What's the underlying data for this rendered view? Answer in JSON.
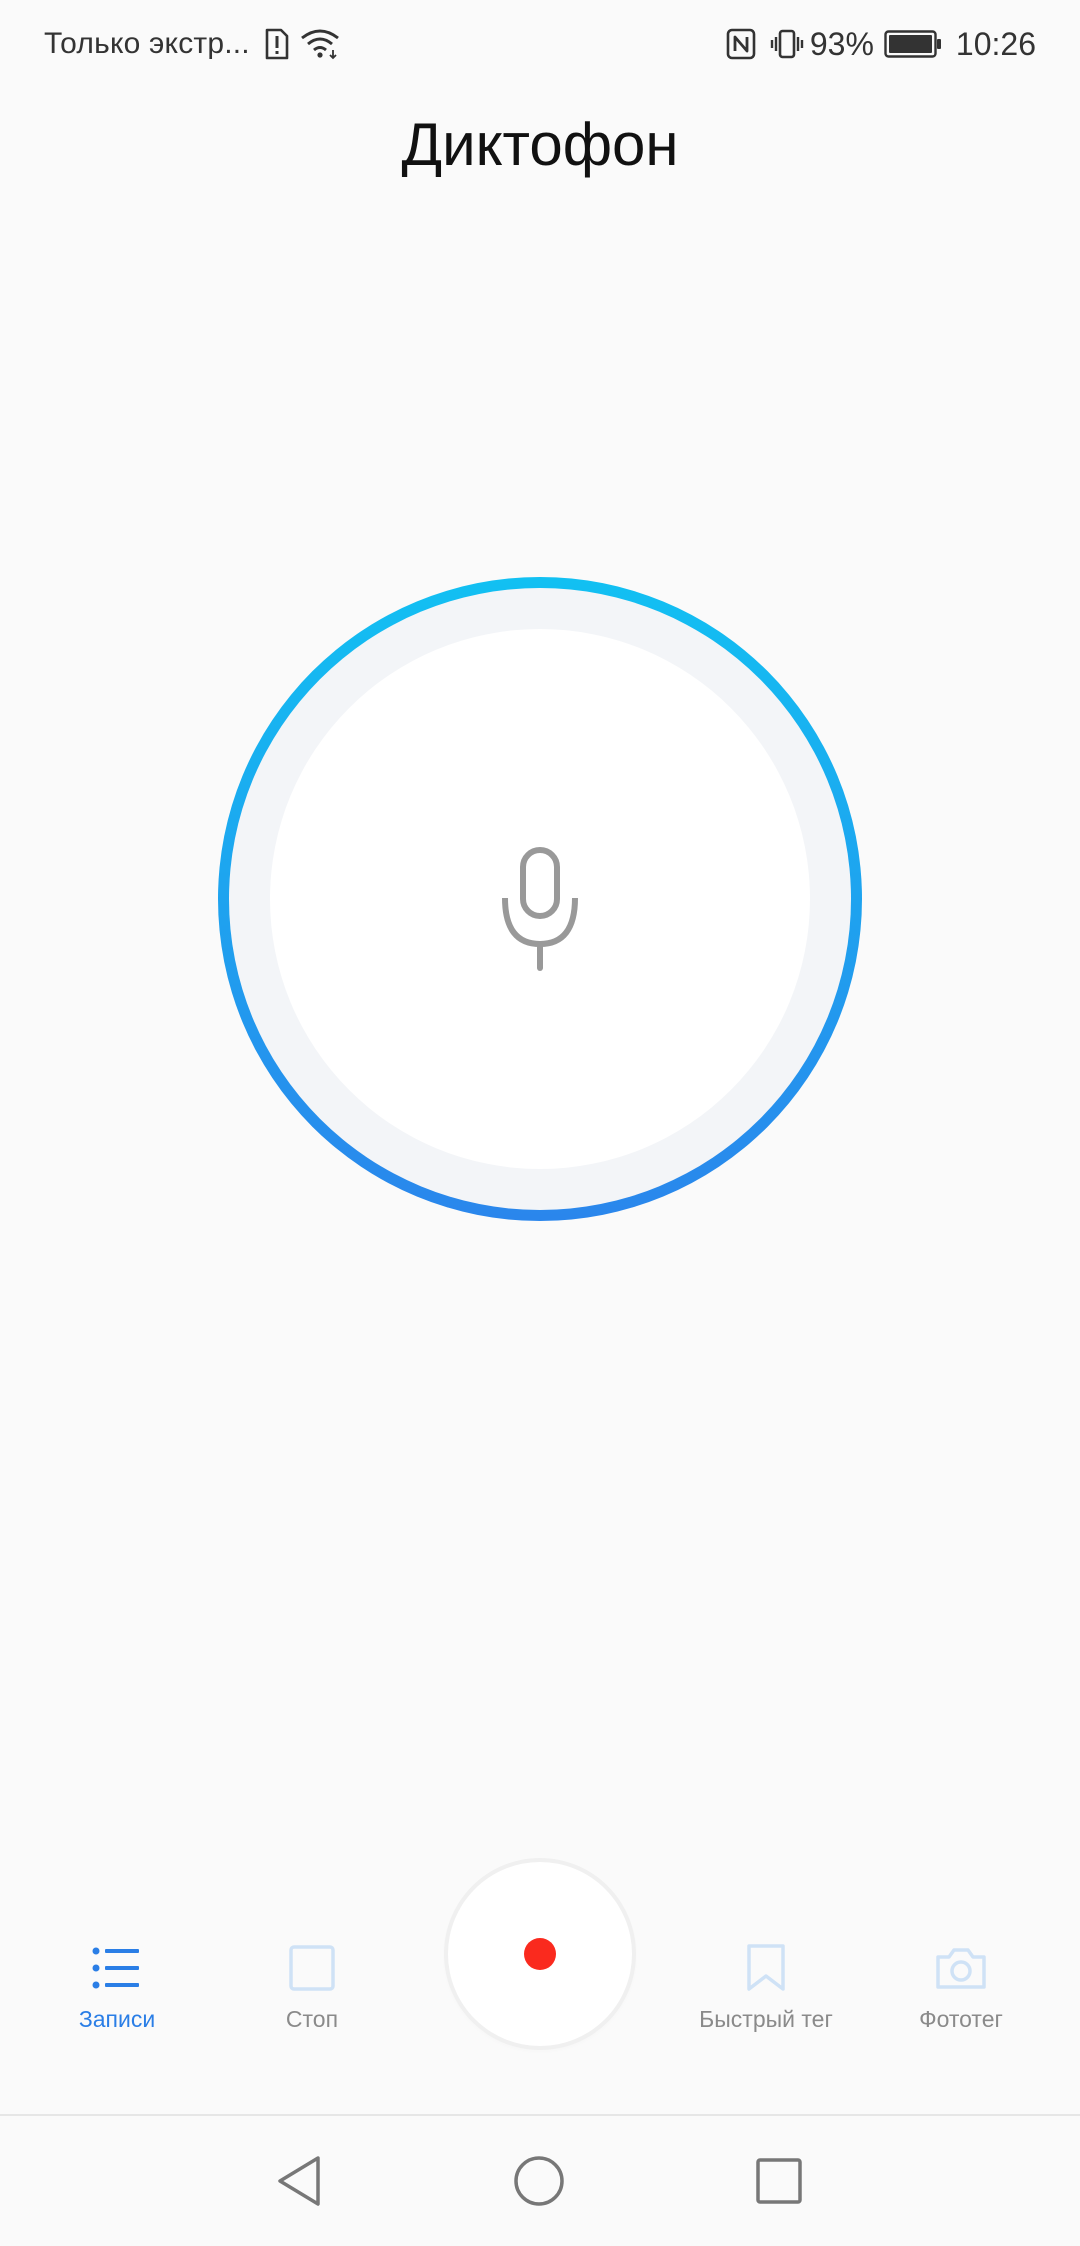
{
  "status_bar": {
    "carrier": "Только экстр...",
    "battery": "93%",
    "time": "10:26",
    "icons": [
      "sim-alert-icon",
      "wifi-icon",
      "nfc-icon",
      "vibrate-icon",
      "battery-icon"
    ]
  },
  "app": {
    "title": "Диктофон"
  },
  "center": {
    "icon": "microphone-icon"
  },
  "controls": {
    "records_label": "Записи",
    "stop_label": "Стоп",
    "quick_tag_label": "Быстрый тег",
    "photo_tag_label": "Фототег"
  },
  "nav": {
    "icons": [
      "back-icon",
      "home-icon",
      "recents-icon"
    ]
  },
  "colors": {
    "ring_top": "#12c0f2",
    "ring_bottom": "#2a86ec",
    "accent": "#2a7ee6",
    "record": "#fa2a1e",
    "disabled_icon": "#cfe2f6"
  }
}
